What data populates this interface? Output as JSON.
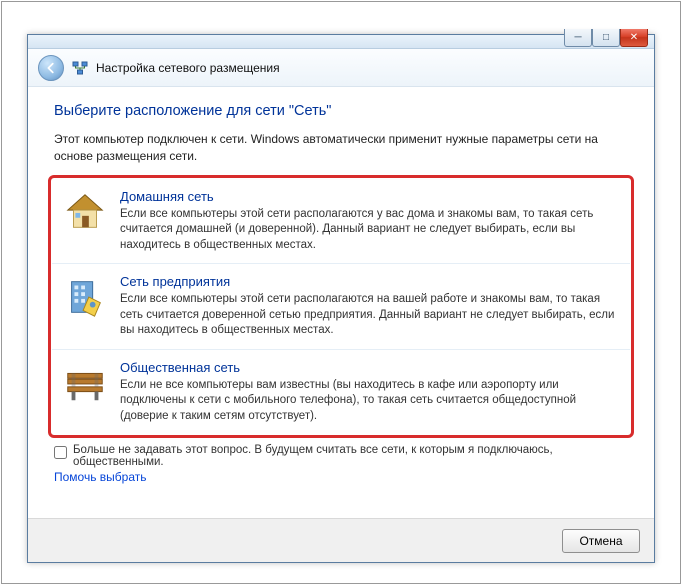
{
  "titlebar": {
    "nav_title": "Настройка сетевого размещения"
  },
  "heading": "Выберите расположение для сети \"Сеть\"",
  "intro": "Этот компьютер подключен к сети. Windows автоматически применит нужные параметры сети на основе размещения сети.",
  "options": [
    {
      "title": "Домашняя сеть",
      "desc": "Если все компьютеры этой сети располагаются у вас дома и знакомы вам, то такая сеть считается домашней (и доверенной). Данный вариант не следует выбирать, если вы находитесь в общественных местах."
    },
    {
      "title": "Сеть предприятия",
      "desc": "Если все компьютеры этой сети располагаются на вашей работе и знакомы вам, то такая сеть считается доверенной сетью предприятия. Данный вариант не следует выбирать, если вы находитесь в общественных местах."
    },
    {
      "title": "Общественная сеть",
      "desc": "Если не все компьютеры вам известны (вы находитесь в кафе или аэропорту или подключены к сети с мобильного телефона), то такая сеть считается общедоступной (доверие к таким сетям отсутствует)."
    }
  ],
  "checkbox_label": "Больше не задавать этот вопрос. В будущем считать все сети, к которым я подключаюсь, общественными.",
  "help_link": "Помочь выбрать",
  "footer": {
    "cancel": "Отмена"
  }
}
